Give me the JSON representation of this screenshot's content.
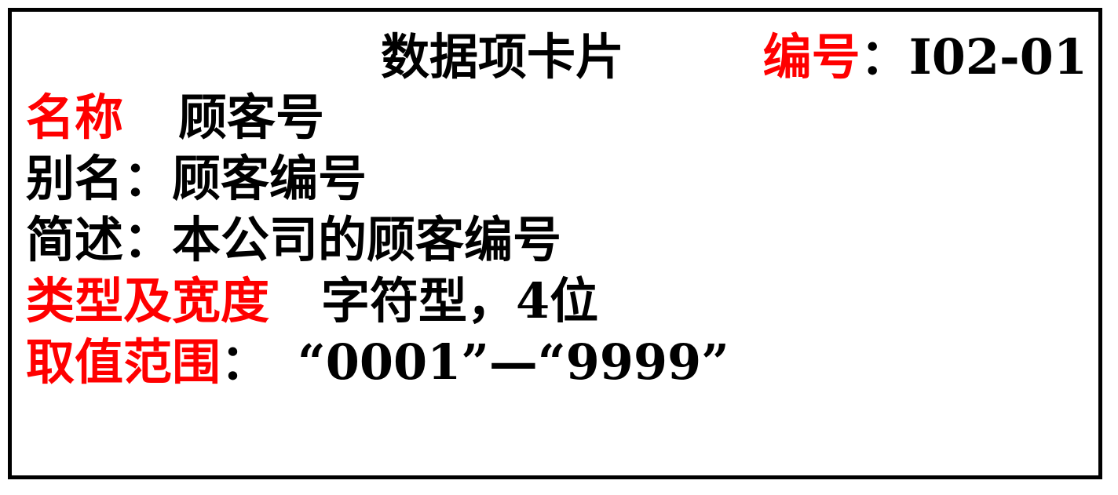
{
  "card": {
    "title": "数据项卡片",
    "code_label": "编号",
    "code_sep": "：",
    "code_value": "I02-01"
  },
  "fields": {
    "name_label": "名称",
    "name_value": "顾客号",
    "alias_label": "别名：",
    "alias_value": "顾客编号",
    "desc_label": "简述：",
    "desc_value": "本公司的顾客编号",
    "type_label": "类型及宽度",
    "type_value": "字符型，4位",
    "range_label": "取值范围",
    "range_sep": "：",
    "range_value": "“0001”—“9999”"
  },
  "colors": {
    "accent": "#ff0000",
    "text": "#000000",
    "border": "#000000",
    "background": "#ffffff"
  }
}
